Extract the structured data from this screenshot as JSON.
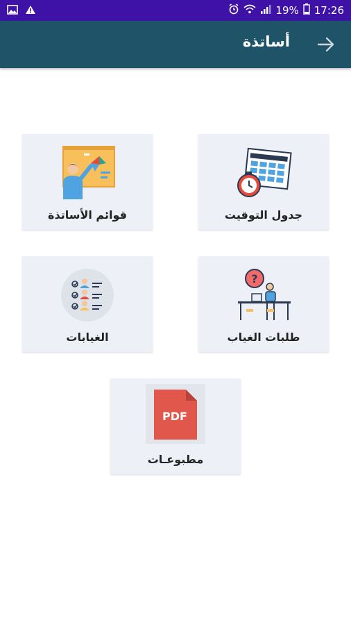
{
  "statusbar": {
    "battery": "19%",
    "time": "17:26"
  },
  "toolbar": {
    "title": "أساتذة"
  },
  "tiles": [
    {
      "label": "جدول التوقيت",
      "icon": "timetable-icon"
    },
    {
      "label": "قوائم الأساتذة",
      "icon": "teacher-board-icon"
    },
    {
      "label": "طلبات الغياب",
      "icon": "absence-request-icon"
    },
    {
      "label": "الغيابات",
      "icon": "attendance-list-icon"
    },
    {
      "label": "مطبوعـات",
      "icon": "pdf-icon"
    }
  ],
  "pdf_badge": "PDF",
  "colors": {
    "statusbar": "#3e12a6",
    "toolbar": "#1f5367",
    "tile_bg": "#eef0f7"
  }
}
